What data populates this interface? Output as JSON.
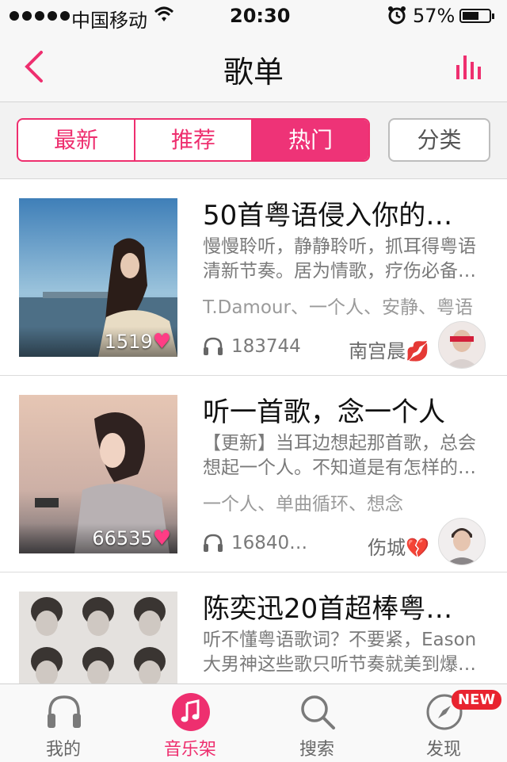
{
  "status_bar": {
    "carrier": "中国移动",
    "time": "20:30",
    "battery": "57%"
  },
  "nav": {
    "title": "歌单"
  },
  "tabs": {
    "items": [
      {
        "label": "最新",
        "active": false
      },
      {
        "label": "推荐",
        "active": false
      },
      {
        "label": "热门",
        "active": true
      }
    ],
    "category_label": "分类"
  },
  "playlists": [
    {
      "title": "50首粤语侵入你的…",
      "description": "慢慢聆听，静静聆听，抓耳得粤语清新节奏。居为情歌，疗伤必备…",
      "tags": "T.Damour、一个人、安静、粤语",
      "likes": "1519",
      "plays": "183744",
      "author": "南宫晨💋"
    },
    {
      "title": "听一首歌，念一个人",
      "description": "【更新】当耳边想起那首歌，总会想起一个人。不知道是有怎样的…",
      "tags": "一个人、单曲循环、想念",
      "likes": "66535",
      "plays": "16840…",
      "author": "伤城💔"
    },
    {
      "title": "陈奕迅20首超棒粤…",
      "description": "听不懂粤语歌词？不要紧，Eason大男神这些歌只听节奏就美到爆…",
      "tags": "",
      "likes": "",
      "plays": "",
      "author": ""
    }
  ],
  "tabbar": {
    "items": [
      {
        "label": "我的",
        "icon": "headphones-icon"
      },
      {
        "label": "音乐架",
        "icon": "music-note-icon",
        "active": true
      },
      {
        "label": "搜索",
        "icon": "search-icon"
      },
      {
        "label": "发现",
        "icon": "compass-icon"
      }
    ],
    "new_badge": "NEW"
  },
  "colors": {
    "accent": "#ee2f6f"
  }
}
